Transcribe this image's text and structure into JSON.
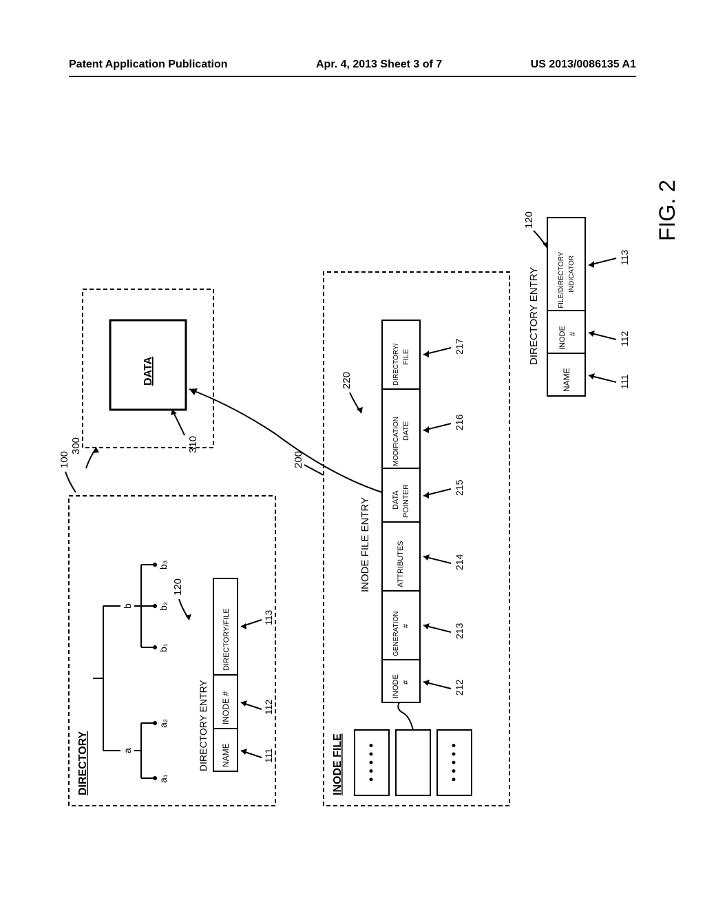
{
  "header": {
    "left": "Patent Application Publication",
    "center": "Apr. 4, 2013  Sheet 3 of 7",
    "right": "US 2013/0086135 A1"
  },
  "figure_label": "FIG. 2",
  "directory_box": {
    "title": "DIRECTORY",
    "ref": "100",
    "nodes": {
      "a": "a",
      "b": "b",
      "a1": "a₁",
      "a2": "a₂",
      "b1": "b₁",
      "b2": "b₂",
      "b3": "b₃"
    },
    "entry_label": "DIRECTORY ENTRY",
    "entry_ref": "120",
    "entry": {
      "name": "NAME",
      "inode": "INODE #",
      "dirfile": "DIRECTORY/FILE",
      "ref_name": "111",
      "ref_inode": "112",
      "ref_dirfile": "113"
    }
  },
  "inode_file_box": {
    "title": "INODE FILE",
    "ref": "200",
    "entry_label": "INODE FILE ENTRY",
    "entry_ref": "220",
    "entry": {
      "inode": "INODE #",
      "gen": "GENERATION #",
      "attr": "ATTRIBUTES",
      "ptr": "DATA POINTER",
      "mod": "MODIFICATION DATE",
      "dirfile": "DIRECTORY/ FILE",
      "ref_inode": "212",
      "ref_gen": "213",
      "ref_attr": "214",
      "ref_ptr": "215",
      "ref_mod": "216",
      "ref_dirfile": "217"
    }
  },
  "data_box": {
    "title": "DATA",
    "ref_outer": "300",
    "ref_inner": "310"
  },
  "directory_entry_2": {
    "label": "DIRECTORY ENTRY",
    "ref": "120",
    "entry": {
      "name": "NAME",
      "inode": "INODE #",
      "dirfile": "FILE/DIRECTORY INDICATOR",
      "ref_name": "111",
      "ref_inode": "112",
      "ref_dirfile": "113"
    }
  }
}
